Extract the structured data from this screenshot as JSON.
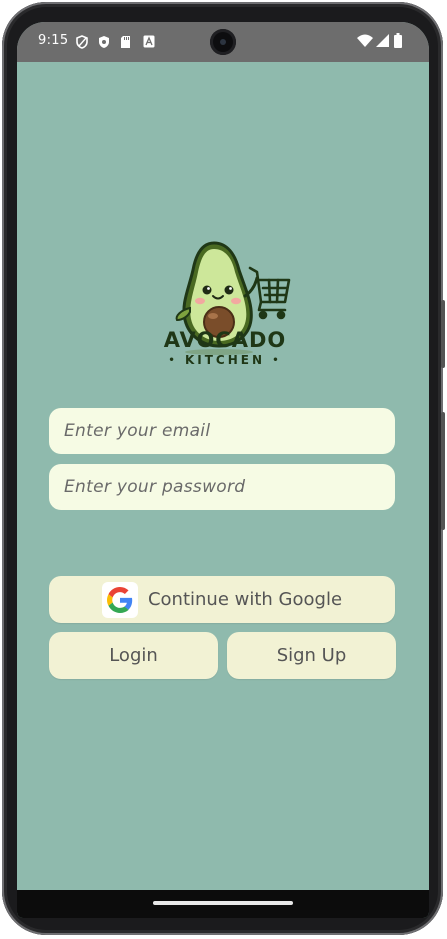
{
  "status_bar": {
    "time": "9:15",
    "left_icons": [
      "shield-outline-icon",
      "shield-check-icon",
      "sd-card-icon",
      "app-a-icon"
    ],
    "right_icons": [
      "wifi-icon",
      "signal-icon",
      "battery-icon"
    ]
  },
  "brand": {
    "title": "AVOCADO",
    "subtitle": "KITCHEN",
    "sub_dot": "•"
  },
  "form": {
    "email_placeholder": "Enter your email",
    "email_value": "",
    "password_placeholder": "Enter your password",
    "password_value": ""
  },
  "buttons": {
    "google_label": "Continue with Google",
    "login_label": "Login",
    "signup_label": "Sign Up"
  },
  "colors": {
    "background": "#8fbaad",
    "status_bar": "#6d6d6d",
    "input_bg": "#f6fbe4",
    "button_bg": "#f2f2d4",
    "brand_text": "#1f3716"
  }
}
